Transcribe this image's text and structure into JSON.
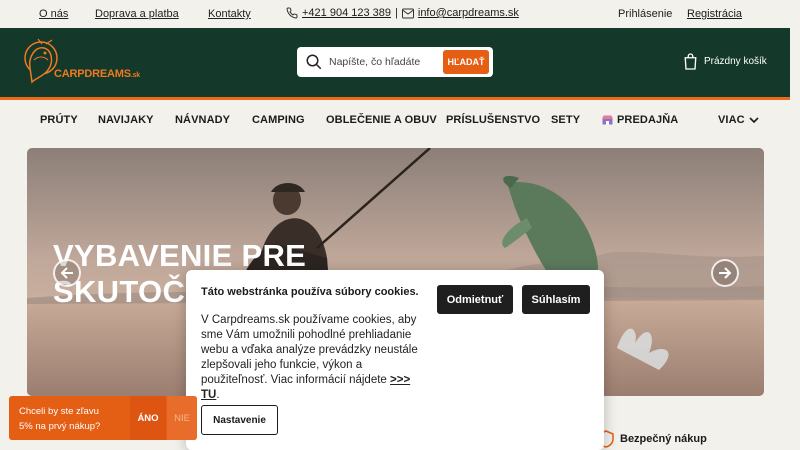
{
  "topbar": {
    "links": [
      "O nás",
      "Doprava a platba",
      "Kontakty"
    ],
    "phone": "+421 904 123 389",
    "separator": "|",
    "email": "info@carpdreams.sk",
    "login": "Prihlásenie",
    "register": "Registrácia"
  },
  "header": {
    "logo_text": "CARPDREAMS",
    "logo_suffix": ".sk",
    "search_placeholder": "Napíšte, čo hľadáte",
    "search_button": "HĽADAŤ",
    "cart_label": "Prázdny košík"
  },
  "nav": {
    "items": [
      "PRÚTY",
      "NAVIJAKY",
      "NÁVNADY",
      "CAMPING",
      "OBLEČENIE A OBUV",
      "PRÍSLUŠENSTVO",
      "SETY"
    ],
    "store": "PREDAJŇA",
    "more": "VIAC"
  },
  "hero": {
    "title_line1": "VYBAVENIE PRE",
    "title_line2": "SKUTOČ"
  },
  "cookie": {
    "title": "Táto webstránka používa súbory cookies.",
    "text": "V Carpdreams.sk používame cookies, aby sme Vám umožnili pohodlné prehliadanie webu a vďaka analýze prevádzky neustále zlepšovali jeho funkcie, výkon a použiteľnosť. Viac informácií nájdete",
    "more_link": ">>> TU",
    "after_link": ".",
    "decline": "Odmietnuť",
    "accept": "Súhlasím",
    "settings": "Nastavenie"
  },
  "below": {
    "safe_shopping": "Bezpečný nákup"
  },
  "promo": {
    "line1": "Chceli by ste zľavu",
    "line2": "5% na prvý nákup?",
    "yes": "ÁNO",
    "no": "NIE"
  },
  "colors": {
    "header_green": "#14382a",
    "accent_orange": "#e45e14",
    "background": "#f3f1ec"
  }
}
